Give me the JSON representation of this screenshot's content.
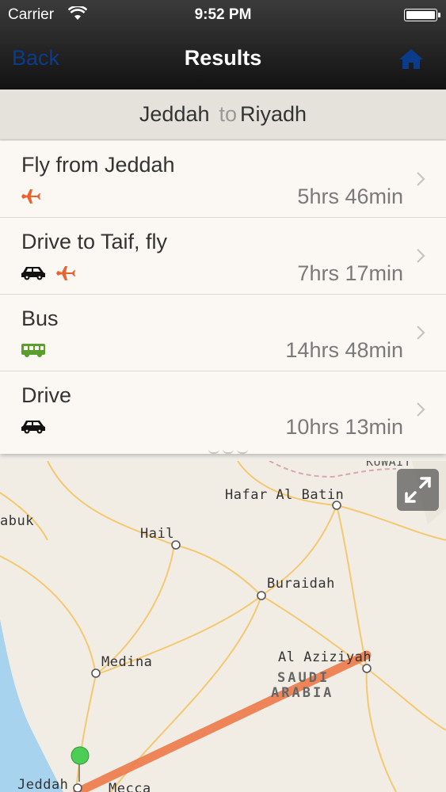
{
  "status": {
    "carrier": "Carrier",
    "time": "9:52 PM"
  },
  "nav": {
    "back_label": "Back",
    "title": "Results",
    "home_icon": "home-icon"
  },
  "route": {
    "from": "Jeddah",
    "to_word": "to",
    "to": "Riyadh"
  },
  "results": [
    {
      "label": "Fly from Jeddah",
      "duration": "5hrs 46min",
      "icons": [
        "plane-icon"
      ]
    },
    {
      "label": "Drive to Taif, fly",
      "duration": "7hrs 17min",
      "icons": [
        "car-icon",
        "plane-icon"
      ]
    },
    {
      "label": "Bus",
      "duration": "14hrs 48min",
      "icons": [
        "bus-icon"
      ]
    },
    {
      "label": "Drive",
      "duration": "10hrs 13min",
      "icons": [
        "car-icon"
      ]
    }
  ],
  "map": {
    "labels": {
      "kuwait": "KUWAIT",
      "hafar": "Hafar Al Batin",
      "tabuk": "abuk",
      "hail": "Hail",
      "buraidah": "Buraidah",
      "medina": "Medina",
      "aziziyah": "Al Aziziyah",
      "saudi": "SAUDI",
      "arabia": "ARABIA",
      "jeddah": "Jeddah",
      "mecca": "Mecca"
    }
  },
  "colors": {
    "plane": "#e8642c",
    "bus": "#5a9e2e",
    "route_line": "#ee7a4a",
    "pin": "#4ccd55"
  }
}
